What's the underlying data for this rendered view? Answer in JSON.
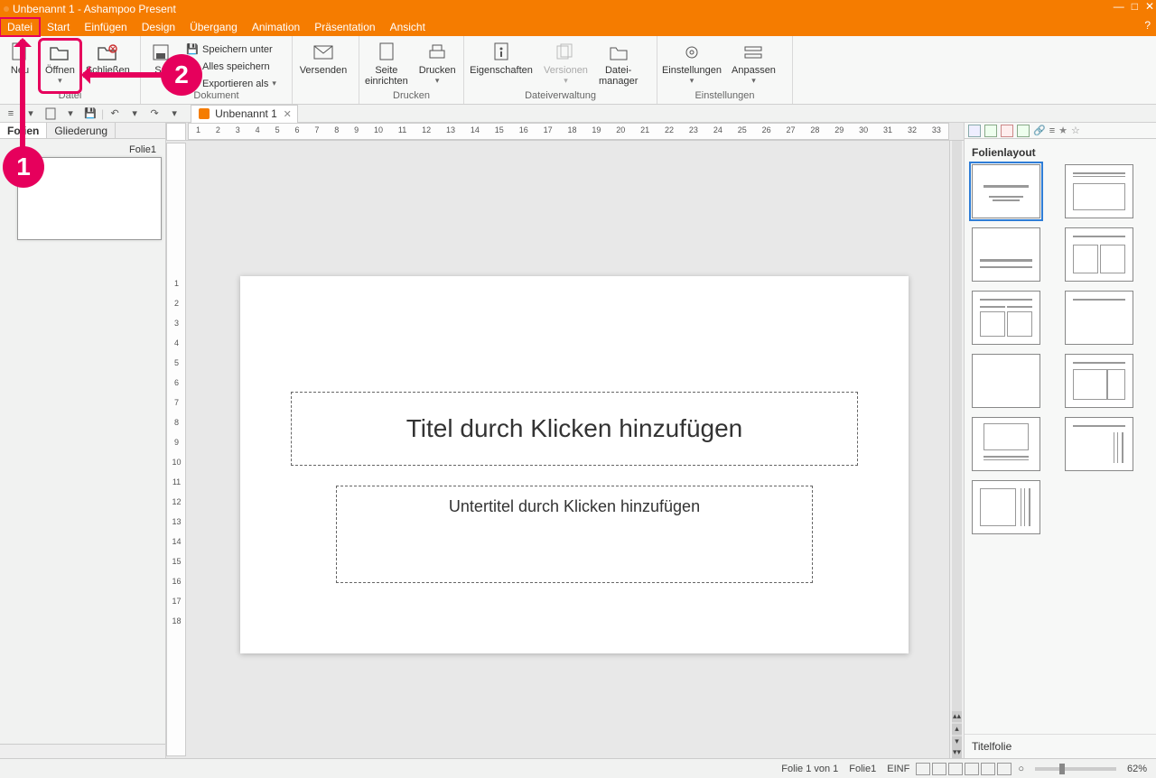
{
  "window": {
    "title": "Unbenannt 1 - Ashampoo Present"
  },
  "menu": {
    "items": [
      "Datei",
      "Start",
      "Einfügen",
      "Design",
      "Übergang",
      "Animation",
      "Präsentation",
      "Ansicht"
    ]
  },
  "ribbon": {
    "file_group_label": "Datei",
    "doc_group_label": "Dokument",
    "print_group_label": "Drucken",
    "manage_group_label": "Dateiverwaltung",
    "settings_group_label": "Einstellungen",
    "btn_new": "Neu",
    "btn_open": "Öffnen",
    "btn_close": "Schließen",
    "btn_save": "Sp",
    "save_as": "Speichern unter",
    "save_all": "Alles speichern",
    "export_as": "Exportieren als",
    "btn_send": "Versenden",
    "btn_pagesetup": "Seite\neinrichten",
    "btn_print": "Drucken",
    "btn_props": "Eigenschaften",
    "btn_versions": "Versionen",
    "btn_filemgr": "Datei-\nmanager",
    "btn_options": "Einstellungen",
    "btn_customize": "Anpassen"
  },
  "doc_tab": {
    "label": "Unbenannt 1"
  },
  "slidepanel": {
    "tab_slides": "Folien",
    "tab_outline": "Gliederung",
    "thumb1_label": "Folie1"
  },
  "canvas": {
    "title_placeholder": "Titel durch Klicken hinzufügen",
    "subtitle_placeholder": "Untertitel durch Klicken hinzufügen"
  },
  "rightpanel": {
    "layout_title": "Folienlayout",
    "current_layout": "Titelfolie"
  },
  "statusbar": {
    "slide_of": "Folie 1 von 1",
    "slide_name": "Folie1",
    "insmode": "EINF",
    "zoom": "62%"
  },
  "ruler_h": [
    "1",
    "2",
    "3",
    "4",
    "5",
    "6",
    "7",
    "8",
    "9",
    "10",
    "11",
    "12",
    "13",
    "14",
    "15",
    "16",
    "17",
    "18",
    "19",
    "20",
    "21",
    "22",
    "23",
    "24",
    "25",
    "26",
    "27",
    "28",
    "29",
    "30",
    "31",
    "32",
    "33"
  ],
  "ruler_v": [
    "1",
    "2",
    "3",
    "4",
    "5",
    "6",
    "7",
    "8",
    "9",
    "10",
    "11",
    "12",
    "13",
    "14",
    "15",
    "16",
    "17",
    "18"
  ],
  "annotations": {
    "n1": "1",
    "n2": "2"
  }
}
